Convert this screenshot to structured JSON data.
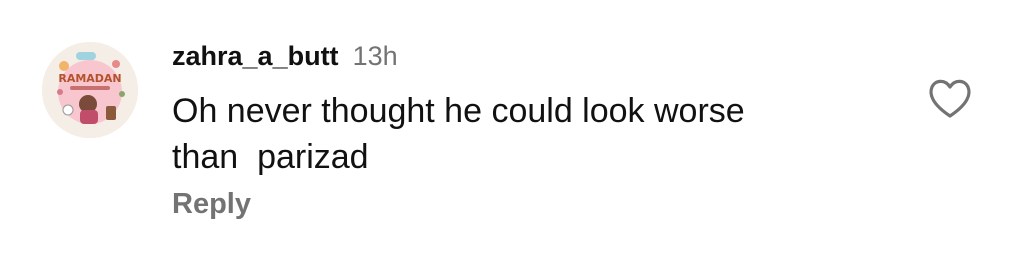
{
  "comment": {
    "username": "zahra_a_butt",
    "time": "13h",
    "text": "Oh never thought he could look worse\nthan  parizad",
    "reply_label": "Reply",
    "avatar_text": "RAMADAN"
  },
  "icons": {
    "like": "heart-outline-icon"
  },
  "colors": {
    "primary_text": "#111111",
    "secondary_text": "#737373",
    "background": "#ffffff"
  }
}
